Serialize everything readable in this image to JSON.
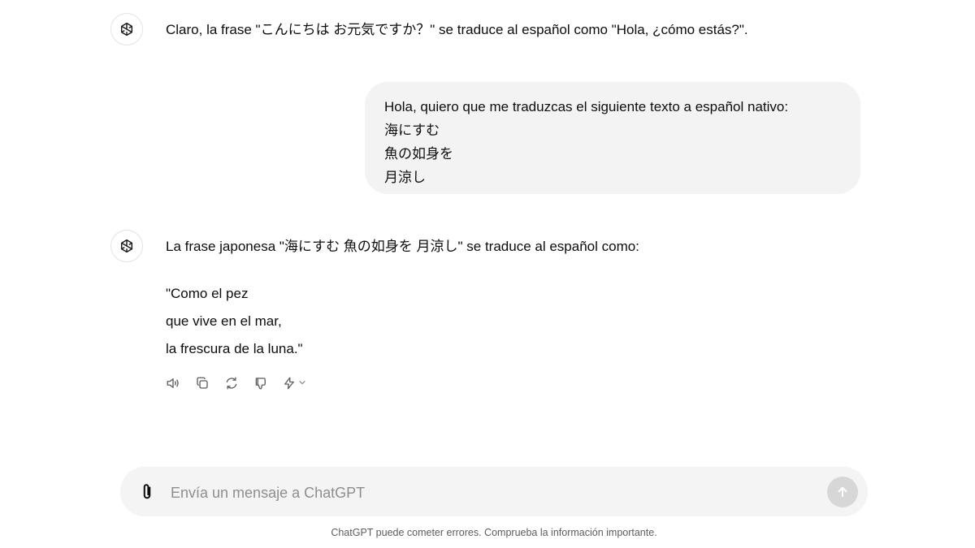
{
  "conversation": {
    "assistant_1": {
      "avatar_icon": "openai-logo-icon",
      "text": "Claro, la frase \"こんにちは お元気ですか？\" se traduce al español como \"Hola, ¿cómo estás?\"."
    },
    "user_1": {
      "lines": [
        "Hola, quiero que me traduzcas el siguiente texto a español nativo:",
        "海にすむ",
        "魚の如身を",
        "月涼し"
      ]
    },
    "assistant_2": {
      "avatar_icon": "openai-logo-icon",
      "intro": "La frase japonesa \"海にすむ 魚の如身を 月涼し\" se traduce al español como:",
      "poem": [
        "\"Como el pez",
        "que vive en el mar,",
        "la frescura de la luna.\""
      ],
      "actions": [
        "read-aloud-icon",
        "copy-icon",
        "regenerate-icon",
        "thumbs-down-icon",
        "lightning-icon",
        "chevron-down-icon"
      ]
    }
  },
  "composer": {
    "placeholder": "Envía un mensaje a ChatGPT",
    "value": "",
    "attach_icon": "paperclip-icon",
    "send_icon": "arrow-up-icon"
  },
  "footer": {
    "disclaimer": "ChatGPT puede cometer errores. Comprueba la información importante."
  },
  "colors": {
    "user_bubble": "#f3f3f3",
    "composer_bg": "#f4f4f4",
    "send_disabled": "#d7d7d7",
    "text": "#0d0d0d",
    "muted": "#5d5d5d"
  }
}
